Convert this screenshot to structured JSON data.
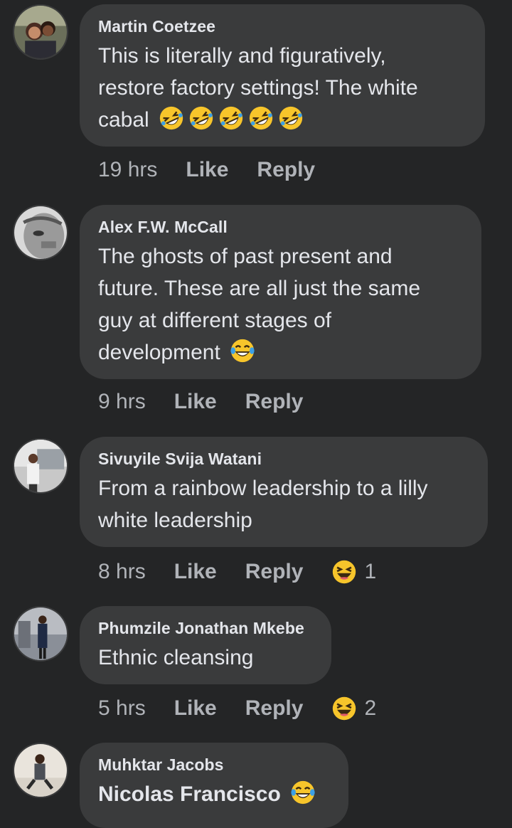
{
  "comments": [
    {
      "author": "Martin Coetzee",
      "lines": [
        "This is literally and figuratively,",
        "restore factory settings! The white",
        "cabal"
      ],
      "emoji": "rolling-on-floor-laughing-icon",
      "time": "19 hrs",
      "like": "Like",
      "reply": "Reply"
    },
    {
      "author": "Alex F.W. McCall",
      "lines": [
        "The ghosts of past present and",
        "future. These are all just the same",
        "guy at different stages of",
        "development"
      ],
      "emoji": "tears-of-joy-icon",
      "time": "9 hrs",
      "like": "Like",
      "reply": "Reply"
    },
    {
      "author": "Sivuyile Svija Watani",
      "lines": [
        "From a rainbow leadership to a lilly",
        "white leadership"
      ],
      "time": "8 hrs",
      "like": "Like",
      "reply": "Reply",
      "reaction_icon": "haha-reaction-icon",
      "reaction_count": "1"
    },
    {
      "author": "Phumzile Jonathan Mkebe",
      "lines": [
        "Ethnic cleansing"
      ],
      "time": "5 hrs",
      "like": "Like",
      "reply": "Reply",
      "reaction_icon": "haha-reaction-icon",
      "reaction_count": "2"
    },
    {
      "author": "Muhktar Jacobs",
      "lines": [
        "Nicolas Francisco"
      ],
      "emoji": "tears-of-joy-icon"
    }
  ],
  "colors": {
    "background": "#242526",
    "bubble": "#3a3b3c",
    "primary_text": "#e4e6eb",
    "secondary_text": "#b0b3b8",
    "emoji_yellow": "#f7c52b"
  }
}
